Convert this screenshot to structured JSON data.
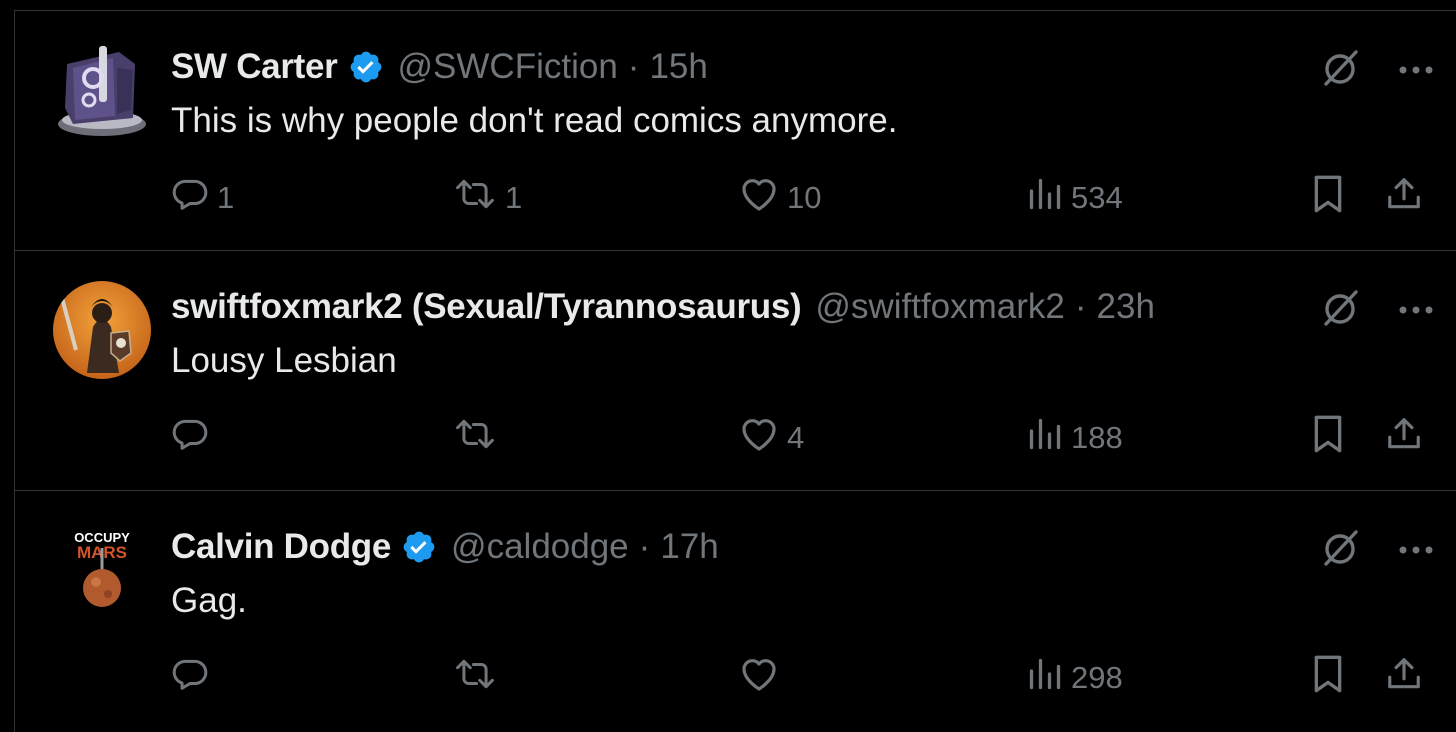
{
  "colors": {
    "background": "#000000",
    "text": "#e7e9ea",
    "muted": "#71767b",
    "border": "#2f3336",
    "verified": "#1d9bf0"
  },
  "tweets": [
    {
      "name": "SW Carter",
      "verified": true,
      "handle": "@SWCFiction",
      "sep": "·",
      "time": "15h",
      "text": "This is why people don't read comics anymore.",
      "replies": "1",
      "reposts": "1",
      "likes": "10",
      "views": "534"
    },
    {
      "name": "swiftfoxmark2 (Sexual/Tyrannosaurus)",
      "verified": false,
      "handle": "@swiftfoxmark2",
      "sep": "·",
      "time": "23h",
      "text": "Lousy Lesbian",
      "replies": "",
      "reposts": "",
      "likes": "4",
      "views": "188"
    },
    {
      "name": "Calvin Dodge",
      "verified": true,
      "handle": "@caldodge",
      "sep": "·",
      "time": "17h",
      "text": "Gag.",
      "replies": "",
      "reposts": "",
      "likes": "",
      "views": "298",
      "avatar_text": [
        "OCCUPY",
        "MARS"
      ]
    }
  ],
  "icons": {
    "reply": "reply-icon",
    "repost": "repost-icon",
    "like": "heart-icon",
    "views": "views-icon",
    "bookmark": "bookmark-icon",
    "share": "share-icon",
    "grok": "grok-icon",
    "more": "more-icon",
    "verified": "verified-badge-icon"
  }
}
